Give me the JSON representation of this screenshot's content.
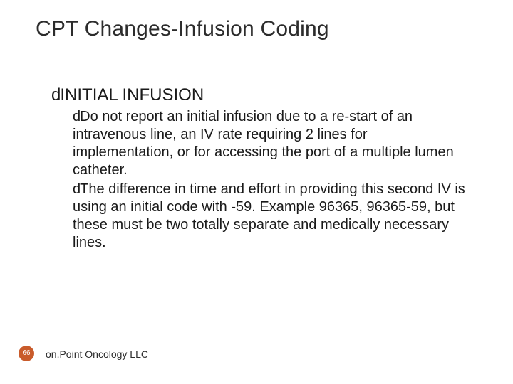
{
  "title": "CPT Changes-Infusion Coding",
  "level1": {
    "text": "INITIAL INFUSION"
  },
  "level2": [
    {
      "text": "Do not report an initial infusion due to a re-start of an intravenous line, an IV rate requiring 2 lines for implementation, or for accessing the port of a multiple lumen catheter."
    },
    {
      "text": "The difference in time and effort in providing this second IV is using an initial code with -59. Example 96365, 96365-59, but these must be two totally separate and medically necessary lines."
    }
  ],
  "page_number": "66",
  "footer": "on.Point Oncology LLC",
  "bullet_glyph": "d"
}
